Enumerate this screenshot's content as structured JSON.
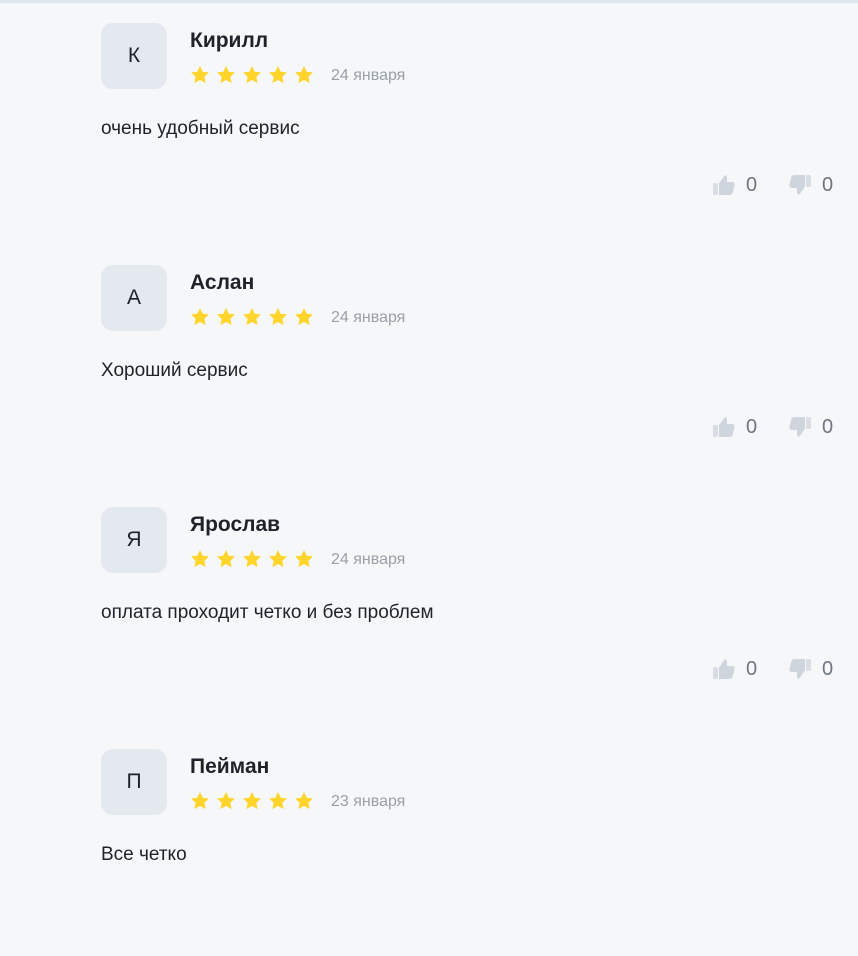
{
  "reviews": [
    {
      "initial": "К",
      "author": "Кирилл",
      "rating": 5,
      "date": "24 января",
      "text": "очень удобный сервис",
      "likes": "0",
      "dislikes": "0"
    },
    {
      "initial": "А",
      "author": "Аслан",
      "rating": 5,
      "date": "24 января",
      "text": "Хороший сервис",
      "likes": "0",
      "dislikes": "0"
    },
    {
      "initial": "Я",
      "author": "Ярослав",
      "rating": 5,
      "date": "24 января",
      "text": "оплата проходит четко и без проблем",
      "likes": "0",
      "dislikes": "0"
    },
    {
      "initial": "П",
      "author": "Пейман",
      "rating": 5,
      "date": "23 января",
      "text": "Все четко"
    }
  ],
  "colors": {
    "background": "#f5f7f9",
    "star": "#ffd52b",
    "avatar": "#e3e9ef",
    "icon": "#cfd5dc",
    "date": "#9aa0a8"
  },
  "icons": {
    "star": "star-icon",
    "like": "thumb-up-icon",
    "dislike": "thumb-down-icon"
  }
}
